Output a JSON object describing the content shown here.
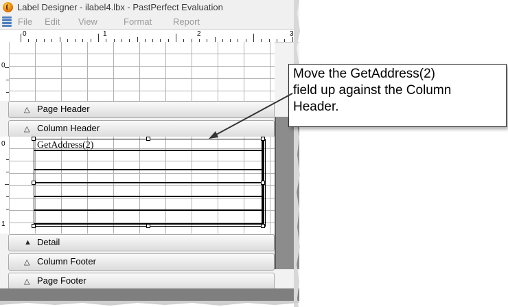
{
  "window": {
    "title": "Label Designer - ilabel4.lbx - PastPerfect Evaluation",
    "icon": "pastperfect-app-icon"
  },
  "menu": [
    "File",
    "Edit",
    "View",
    "Format",
    "Report"
  ],
  "ruler": {
    "labels": [
      "0",
      "1",
      "2",
      "3"
    ]
  },
  "vruler": {
    "top_label": "0",
    "column_labels": [
      "0",
      "1"
    ]
  },
  "bands": [
    {
      "name": "page-header",
      "label": "Page Header",
      "expanded": false
    },
    {
      "name": "column-header",
      "label": "Column Header",
      "expanded": false
    },
    {
      "name": "detail",
      "label": "Detail",
      "expanded": true
    },
    {
      "name": "column-footer",
      "label": "Column Footer",
      "expanded": false
    },
    {
      "name": "page-footer",
      "label": "Page Footer",
      "expanded": false
    }
  ],
  "field": {
    "expression": "GetAddress(2)"
  },
  "callout": {
    "lines": [
      "Move the GetAddress(2)",
      "field up against the Column",
      "Header."
    ]
  },
  "colors": {
    "callout_border": "#333333",
    "band_bar": "#dcdcdc",
    "side_panel": "#8c8c8c"
  }
}
